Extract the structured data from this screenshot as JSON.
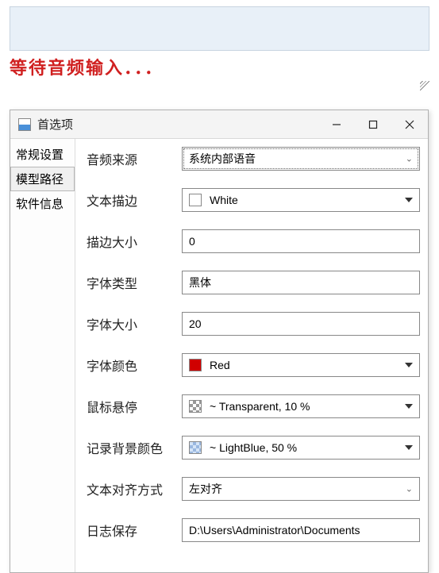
{
  "top_area": {
    "waiting_text": "等待音频输入．．．"
  },
  "window": {
    "title": "首选项",
    "tabs": [
      {
        "label": "常规设置"
      },
      {
        "label": "模型路径"
      },
      {
        "label": "软件信息"
      }
    ],
    "selected_tab_index": 1,
    "form": {
      "audio_source": {
        "label": "音频来源",
        "value": "系统内部语音"
      },
      "text_stroke": {
        "label": "文本描边",
        "value": "White",
        "swatch": "white"
      },
      "stroke_size": {
        "label": "描边大小",
        "value": "0"
      },
      "font_type": {
        "label": "字体类型",
        "value": "黑体"
      },
      "font_size": {
        "label": "字体大小",
        "value": "20"
      },
      "font_color": {
        "label": "字体颜色",
        "value": "Red",
        "swatch": "red"
      },
      "mouse_hover": {
        "label": "鼠标悬停",
        "value": "~ Transparent, 10 %",
        "swatch": "checker"
      },
      "record_bg": {
        "label": "记录背景颜色",
        "value": "~ LightBlue, 50 %",
        "swatch": "checker-blue"
      },
      "text_align": {
        "label": "文本对齐方式",
        "value": "左对齐"
      },
      "log_save": {
        "label": "日志保存",
        "value": "D:\\Users\\Administrator\\Documents"
      }
    }
  }
}
